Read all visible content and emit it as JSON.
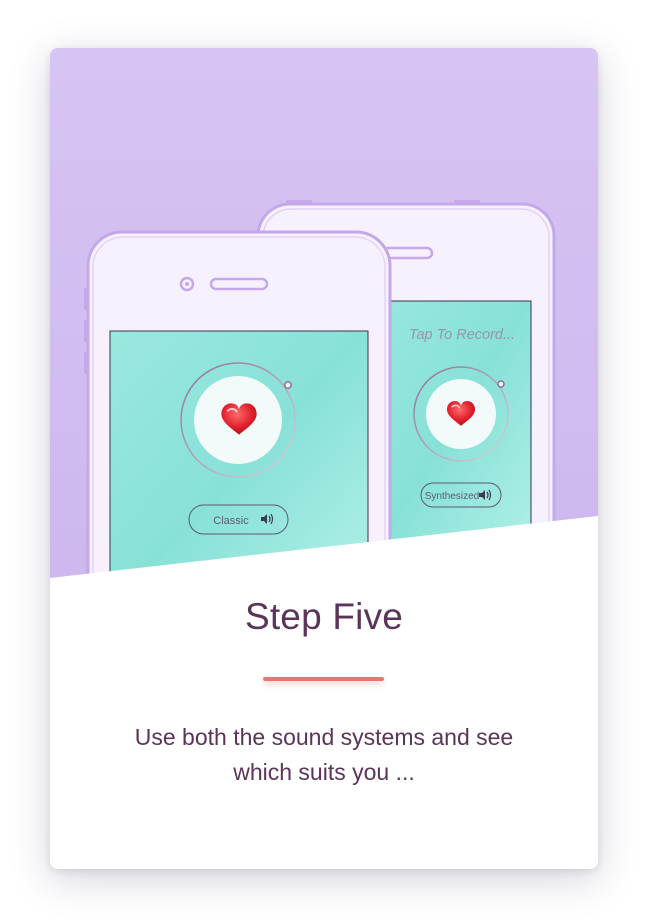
{
  "colors": {
    "hero_background": "#d6c4f2",
    "phone_outline": "#c4a8ea",
    "phone_body": "#f6f1fd",
    "screen_teal": "#8ee5dc",
    "heart_red": "#e0202c",
    "title_text": "#5a3459",
    "accent_divider": "#e6766f"
  },
  "front_phone": {
    "sound_button_label": "Classic",
    "icons": [
      "heart-icon",
      "speaker-icon"
    ]
  },
  "back_phone": {
    "status_text": "Tap To Record...",
    "sound_button_label": "Synthesized",
    "icons": [
      "heart-icon",
      "speaker-icon"
    ]
  },
  "step": {
    "title": "Step Five",
    "description_line1": "Use both the sound systems and see",
    "description_line2": "which suits you ..."
  }
}
